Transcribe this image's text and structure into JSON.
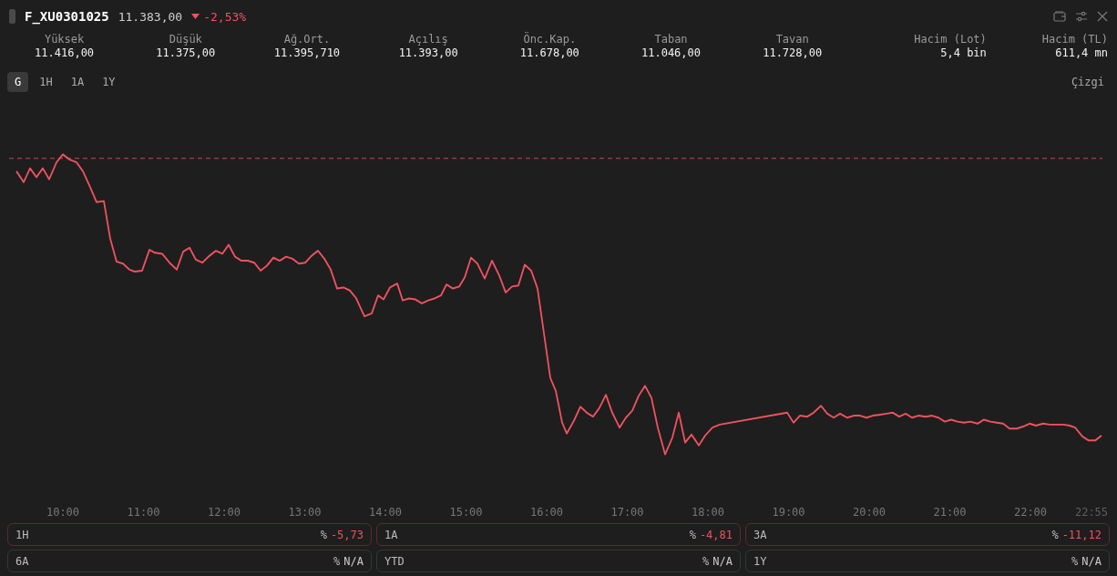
{
  "header": {
    "symbol": "F_XU0301025",
    "price": "11.383,00",
    "change": "-2,53%",
    "negative": true
  },
  "stats": [
    {
      "label": "Yüksek",
      "value": "11.416,00",
      "kind": "price"
    },
    {
      "label": "Düşük",
      "value": "11.375,00",
      "kind": "price"
    },
    {
      "label": "Ağ.Ort.",
      "value": "11.395,710",
      "kind": "price"
    },
    {
      "label": "Açılış",
      "value": "11.393,00",
      "kind": "price"
    },
    {
      "label": "Önc.Kap.",
      "value": "11.678,00",
      "kind": "price"
    },
    {
      "label": "Taban",
      "value": "11.046,00",
      "kind": "price"
    },
    {
      "label": "Tavan",
      "value": "11.728,00",
      "kind": "price"
    },
    {
      "label": "Hacim (Lot)",
      "value": "5,4 bin",
      "kind": "volume"
    },
    {
      "label": "Hacim (TL)",
      "value": "611,4 mn",
      "kind": "volume"
    }
  ],
  "ranges": [
    {
      "label": "G",
      "selected": true
    },
    {
      "label": "1H",
      "selected": false
    },
    {
      "label": "1A",
      "selected": false
    },
    {
      "label": "1Y",
      "selected": false
    }
  ],
  "chart_type": "Çizgi",
  "x_labels": [
    {
      "text": "10:00",
      "kind": "tick"
    },
    {
      "text": "11:00",
      "kind": "tick"
    },
    {
      "text": "12:00",
      "kind": "tick"
    },
    {
      "text": "13:00",
      "kind": "tick"
    },
    {
      "text": "14:00",
      "kind": "tick"
    },
    {
      "text": "15:00",
      "kind": "tick"
    },
    {
      "text": "16:00",
      "kind": "tick"
    },
    {
      "text": "17:00",
      "kind": "tick"
    },
    {
      "text": "18:00",
      "kind": "tick"
    },
    {
      "text": "19:00",
      "kind": "tick"
    },
    {
      "text": "20:00",
      "kind": "tick"
    },
    {
      "text": "21:00",
      "kind": "tick"
    },
    {
      "text": "22:00",
      "kind": "tick"
    },
    {
      "text": "22:55",
      "kind": "end"
    }
  ],
  "periods": [
    {
      "label": "1H",
      "unit": "%",
      "value": "-5,73",
      "negative": true
    },
    {
      "label": "1A",
      "unit": "%",
      "value": "-4,81",
      "negative": true
    },
    {
      "label": "3A",
      "unit": "%",
      "value": "-11,12",
      "negative": true
    },
    {
      "label": "6A",
      "unit": "%",
      "value": "N/A",
      "negative": false
    },
    {
      "label": "YTD",
      "unit": "%",
      "value": "N/A",
      "negative": false
    },
    {
      "label": "1Y",
      "unit": "%",
      "value": "N/A",
      "negative": false
    }
  ]
}
